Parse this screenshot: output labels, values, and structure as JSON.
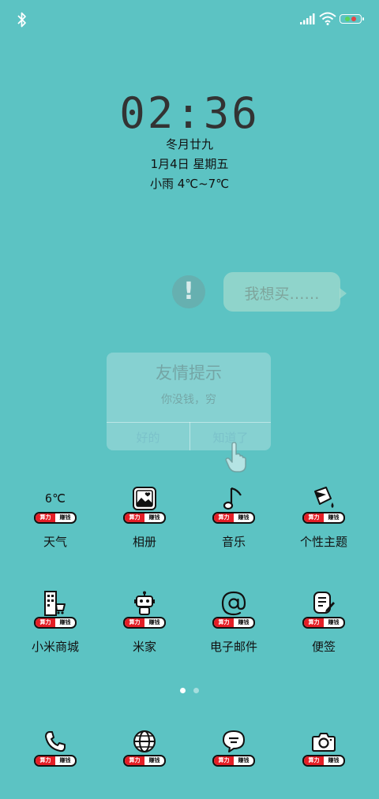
{
  "clock": {
    "time": "02:36",
    "lunar": "冬月廿九",
    "date": "1月4日 星期五",
    "weather": "小雨 4℃~7℃"
  },
  "overlay": {
    "bubble_text": "我想买……",
    "dialog_title": "友情提示",
    "dialog_message": "你没钱，穷",
    "ok_button": "好的",
    "know_button": "知道了"
  },
  "badge": {
    "left": "算力",
    "right": "赚钱"
  },
  "apps": {
    "weather": {
      "label": "天气",
      "temp": "6℃"
    },
    "gallery": {
      "label": "相册"
    },
    "music": {
      "label": "音乐"
    },
    "themes": {
      "label": "个性主题"
    },
    "mistore": {
      "label": "小米商城"
    },
    "mijia": {
      "label": "米家"
    },
    "email": {
      "label": "电子邮件"
    },
    "notes": {
      "label": "便签"
    }
  },
  "page_indicator": {
    "pages": 2,
    "current": 1
  },
  "colors": {
    "background": "#5cc3c3",
    "badge_red": "#e41e26",
    "battery_green": "#5bd35b",
    "battery_red": "#e64545"
  }
}
